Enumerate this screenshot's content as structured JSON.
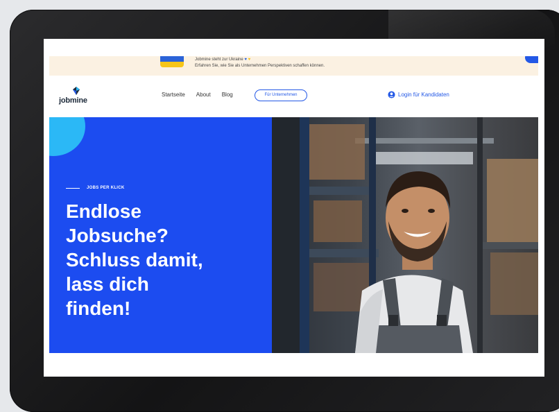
{
  "banner": {
    "line1": "Jobmine steht zur Ukraine",
    "line2": "Erfahren Sie, wie Sie als Unternehmen Perspektiven schaffen können."
  },
  "nav": {
    "logo_text": "jobmine",
    "links": [
      "Startseite",
      "About",
      "Blog"
    ],
    "cta": "Für Unternehmen",
    "login": "Login für Kandidaten"
  },
  "hero": {
    "eyebrow": "JOBS PER KLICK",
    "headline_lines": [
      "Endlose",
      "Jobsuche?",
      "Schluss damit,",
      "lass dich",
      "finden!"
    ]
  },
  "colors": {
    "primary_blue": "#1c4cf0",
    "accent_cyan": "#2bb8f6",
    "banner_bg": "#fbf1e2"
  },
  "icons": {
    "login": "user-circle-icon",
    "logo": "jobmine-logo-icon"
  }
}
